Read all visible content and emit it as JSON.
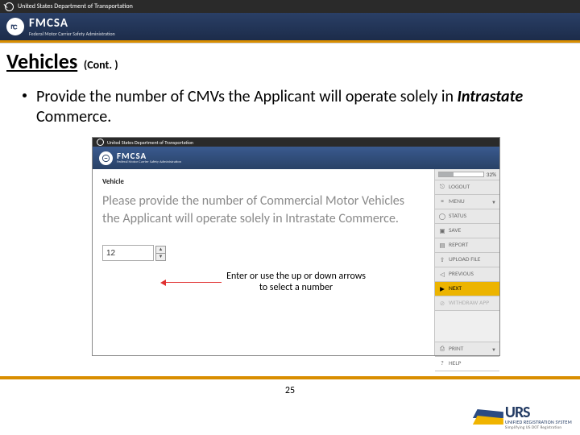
{
  "dot_bar": {
    "label": "United States Department of Transportation"
  },
  "fmcsa_bar": {
    "label": "FMCSA",
    "sub": "Federal Motor Carrier Safety Administration"
  },
  "title": {
    "main": "Vehicles",
    "cont": "(Cont. )"
  },
  "bullet": {
    "pre": "Provide the number of CMVs the Applicant will operate solely in ",
    "em": "Intrastate",
    "post": " Commerce."
  },
  "shot": {
    "dot": "United States Department of Transportation",
    "fmcsa": "FMCSA",
    "fmcsa_sub": "Federal Motor Carrier Safety Administration",
    "crumb": "Vehicle",
    "prompt": "Please provide the number of Commercial Motor Vehicles the Applicant will operate solely in Intrastate Commerce.",
    "value": "12",
    "annot": "Enter or use the up or down arrows to select a number",
    "progress_pct": "32%",
    "side": {
      "logout": "LOGOUT",
      "menu": "MENU",
      "status": "STATUS",
      "save": "SAVE",
      "report": "REPORT",
      "upload": "UPLOAD FILE",
      "previous": "PREVIOUS",
      "next": "NEXT",
      "withdraw": "WITHDRAW APP",
      "print": "PRINT",
      "help": "HELP"
    }
  },
  "page_number": "25",
  "urs": {
    "big": "URS",
    "small": "UNIFIED REGISTRATION SYSTEM",
    "tag": "Simplifying US DOT Registration"
  }
}
